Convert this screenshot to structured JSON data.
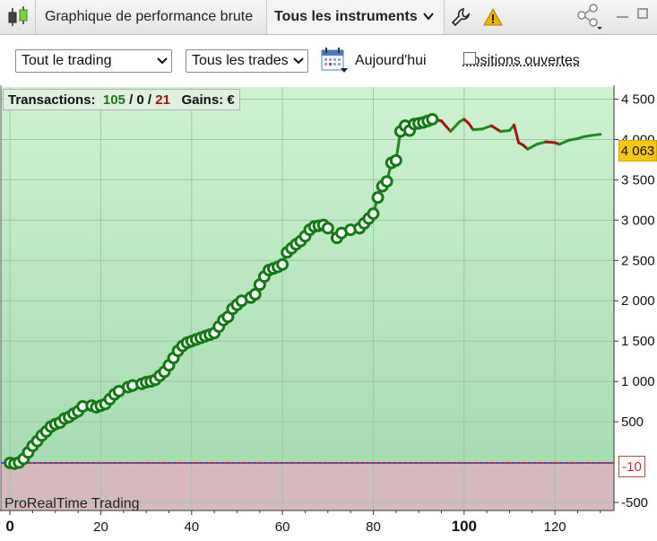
{
  "tabs": {
    "performance": "Graphique de performance brute",
    "instruments": "Tous les instruments"
  },
  "filters": {
    "trading": "Tout le trading",
    "trades": "Tous les trades",
    "today": "Aujourd'hui",
    "open_positions": "Positions ouvertes"
  },
  "stats": {
    "label": "Transactions:",
    "winners": "105",
    "sep1": " / ",
    "neutral": "0",
    "sep2": " / ",
    "losers": "21",
    "gains_label": "Gains: €"
  },
  "brand": "ProRealTime Trading",
  "price_tag": "4 063",
  "zero_tag": "-10",
  "colors": {
    "up": "#1f8a1f",
    "down": "#a31515",
    "bg_up": "#c4ecc8",
    "bg_down": "#d5b9bf",
    "tag": "#f5c518"
  },
  "chart_data": {
    "type": "line",
    "x_ticks": [
      "0",
      "20",
      "40",
      "60",
      "80",
      "100",
      "120"
    ],
    "y_ticks": [
      "4 500",
      "4 000",
      "3 500",
      "3 000",
      "2 500",
      "2 000",
      "1 500",
      "1 000",
      "500",
      "-500"
    ],
    "xlim": [
      -2,
      133
    ],
    "ylim": [
      -600,
      4650
    ],
    "zero_line": -10,
    "last_value": 4063,
    "series": [
      {
        "points": [
          [
            0,
            -10
          ],
          [
            1,
            -20
          ],
          [
            2,
            -5
          ],
          [
            3,
            40
          ],
          [
            4,
            120
          ],
          [
            5,
            200
          ],
          [
            6,
            260
          ],
          [
            7,
            330
          ],
          [
            8,
            380
          ],
          [
            9,
            440
          ],
          [
            10,
            470
          ],
          [
            11,
            490
          ],
          [
            12,
            540
          ],
          [
            13,
            560
          ],
          [
            14,
            600
          ],
          [
            15,
            630
          ],
          [
            16,
            690
          ],
          [
            18,
            700
          ],
          [
            19,
            680
          ],
          [
            20,
            700
          ],
          [
            21,
            720
          ],
          [
            22,
            780
          ],
          [
            23,
            840
          ],
          [
            24,
            880
          ],
          [
            26,
            930
          ],
          [
            27,
            950
          ],
          [
            29,
            970
          ],
          [
            30,
            990
          ],
          [
            31,
            1000
          ],
          [
            32,
            1020
          ],
          [
            33,
            1070
          ],
          [
            34,
            1120
          ],
          [
            35,
            1200
          ],
          [
            36,
            1290
          ],
          [
            37,
            1380
          ],
          [
            38,
            1440
          ],
          [
            39,
            1480
          ],
          [
            40,
            1500
          ],
          [
            41,
            1520
          ],
          [
            42,
            1540
          ],
          [
            43,
            1560
          ],
          [
            44,
            1580
          ],
          [
            45,
            1600
          ],
          [
            46,
            1680
          ],
          [
            47,
            1760
          ],
          [
            48,
            1800
          ],
          [
            49,
            1900
          ],
          [
            50,
            1950
          ],
          [
            51,
            2000
          ],
          [
            53,
            2040
          ],
          [
            54,
            2080
          ],
          [
            55,
            2200
          ],
          [
            56,
            2300
          ],
          [
            57,
            2380
          ],
          [
            58,
            2400
          ],
          [
            59,
            2420
          ],
          [
            60,
            2450
          ],
          [
            61,
            2600
          ],
          [
            62,
            2650
          ],
          [
            63,
            2700
          ],
          [
            64,
            2740
          ],
          [
            65,
            2800
          ],
          [
            66,
            2880
          ],
          [
            67,
            2920
          ],
          [
            68,
            2930
          ],
          [
            69,
            2940
          ],
          [
            70,
            2900
          ],
          [
            72,
            2780
          ],
          [
            73,
            2840
          ],
          [
            75,
            2880
          ],
          [
            77,
            2900
          ],
          [
            78,
            2960
          ],
          [
            79,
            3020
          ],
          [
            80,
            3080
          ],
          [
            81,
            3280
          ],
          [
            82,
            3420
          ],
          [
            83,
            3480
          ],
          [
            84,
            3710
          ],
          [
            85,
            3740
          ],
          [
            86,
            4100
          ],
          [
            87,
            4170
          ],
          [
            88,
            4110
          ],
          [
            89,
            4190
          ],
          [
            90,
            4200
          ],
          [
            91,
            4210
          ],
          [
            92,
            4230
          ],
          [
            93,
            4250
          ],
          [
            95,
            4230
          ],
          [
            97,
            4100
          ],
          [
            99,
            4220
          ],
          [
            100,
            4250
          ],
          [
            101,
            4200
          ],
          [
            102,
            4120
          ],
          [
            104,
            4130
          ],
          [
            106,
            4170
          ],
          [
            108,
            4100
          ],
          [
            110,
            4110
          ],
          [
            111,
            4180
          ],
          [
            112,
            3960
          ],
          [
            113,
            3930
          ],
          [
            114,
            3880
          ],
          [
            116,
            3940
          ],
          [
            118,
            3970
          ],
          [
            120,
            3960
          ],
          [
            121,
            3940
          ],
          [
            123,
            3990
          ],
          [
            125,
            4010
          ],
          [
            126,
            4030
          ],
          [
            128,
            4050
          ],
          [
            130,
            4063
          ]
        ],
        "marker_count": 93
      }
    ]
  }
}
